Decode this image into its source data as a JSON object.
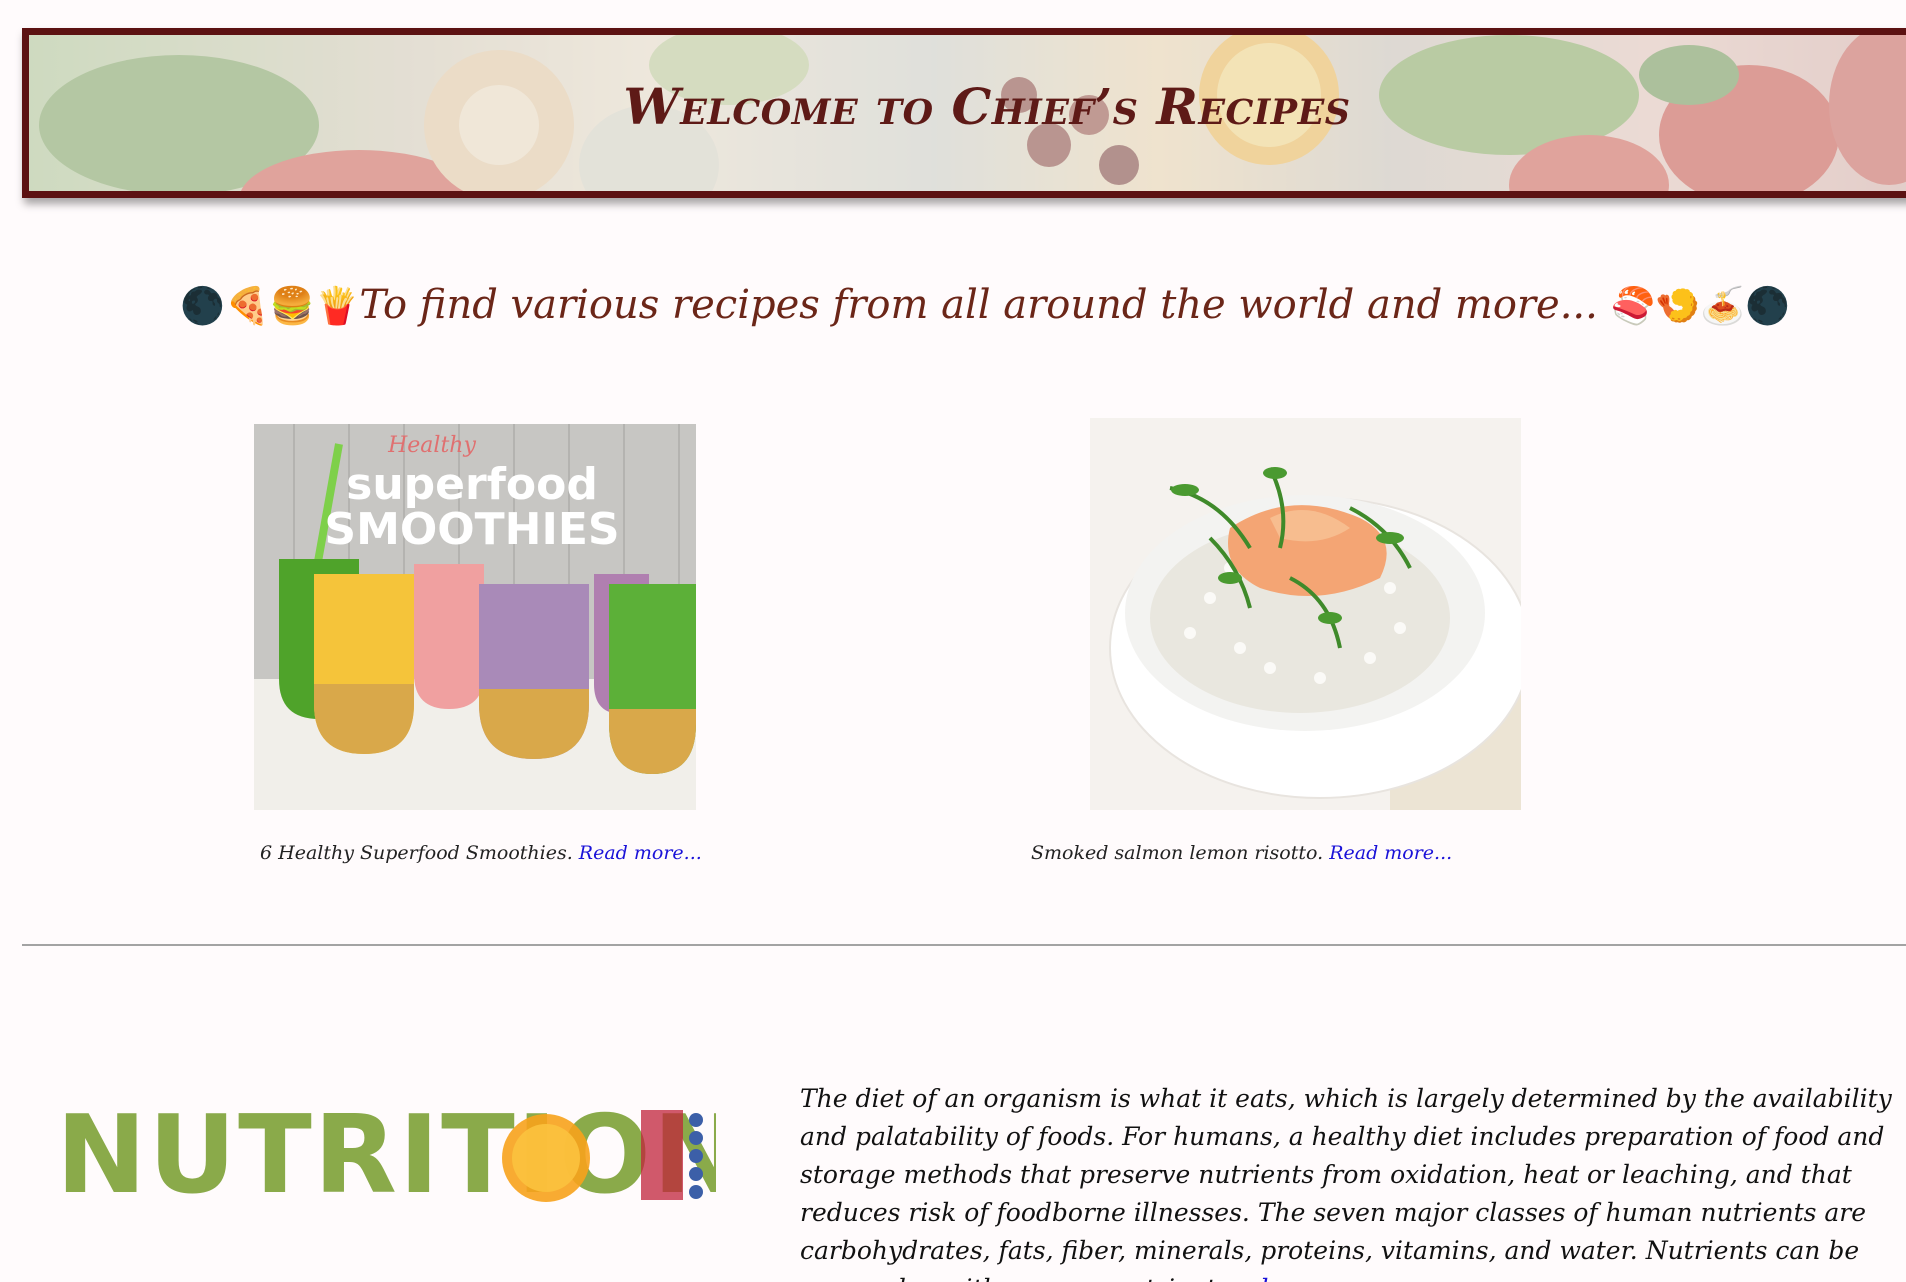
{
  "header": {
    "title": "Welcome to Chief’s Recipes"
  },
  "tagline": {
    "lead_emojis": "🌑🍕🍔🍟",
    "text": "To find various recipes from all around the world and more...",
    "trail_emojis": "🍣🍤🍝🌑"
  },
  "recipes": [
    {
      "image_overlay_small": "Healthy",
      "image_overlay_line1": "superfood",
      "image_overlay_line2": "SMOOTHIES",
      "caption": "6 Healthy Superfood Smoothies.",
      "link_label": "Read more..."
    },
    {
      "caption": "Smoked salmon lemon risotto.",
      "link_label": "Read more..."
    }
  ],
  "nutrition": {
    "logo_text": "NUTRITION",
    "paragraph": "The diet of an organism is what it eats, which is largely determined by the availability and palatability of foods. For humans, a healthy diet includes preparation of food and storage methods that preserve nutrients from oxidation, heat or leaching, and that reduces risk of foodborne illnesses. The seven major classes of human nutrients are carbohydrates, fats, fiber, minerals, proteins, vitamins, and water. Nutrients can be grouped as either macronutrients...",
    "link_label": "learn more..."
  },
  "colors": {
    "title": "#5e1a17",
    "banner_border": "#5c1212",
    "link": "#1a12d8",
    "tagline": "#6b2618"
  }
}
